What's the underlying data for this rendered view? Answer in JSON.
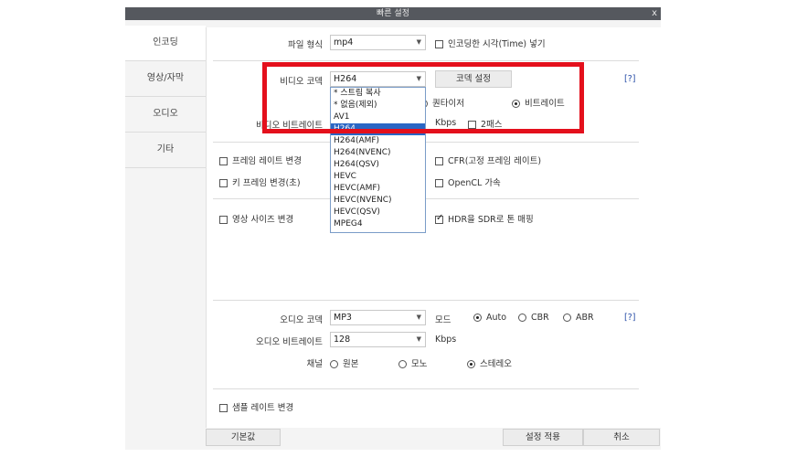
{
  "window": {
    "title": "빠른 설정",
    "close": "x"
  },
  "tabs": [
    {
      "label": "인코딩",
      "active": true
    },
    {
      "label": "영상/자막",
      "active": false
    },
    {
      "label": "오디오",
      "active": false
    },
    {
      "label": "기타",
      "active": false
    }
  ],
  "file_format": {
    "label": "파일 형식",
    "value": "mp4"
  },
  "time_option": {
    "label": "인코딩한 시각(Time) 넣기",
    "checked": false
  },
  "video_codec": {
    "label": "비디오 코덱",
    "value": "H264",
    "settings_button": "코덱 설정",
    "help": "[?]"
  },
  "quality_mode": {
    "options": [
      {
        "label": "퀀타이저",
        "selected": false
      },
      {
        "label": "비트레이트",
        "selected": true
      }
    ]
  },
  "video_bitrate": {
    "label": "비디오 비트레이트",
    "unit": "Kbps",
    "two_pass_label": "2패스",
    "two_pass_checked": false
  },
  "codec_dropdown": {
    "options": [
      "* 스트림 복사",
      "* 없음(제외)",
      "AV1",
      "H264",
      "H264(AMF)",
      "H264(NVENC)",
      "H264(QSV)",
      "HEVC",
      "HEVC(AMF)",
      "HEVC(NVENC)",
      "HEVC(QSV)",
      "MPEG4"
    ],
    "highlighted": "H264"
  },
  "checks": {
    "frame_rate": {
      "label": "프레임 레이트 변경",
      "checked": false
    },
    "cfr": {
      "label": "CFR(고정 프레임 레이트)",
      "checked": false
    },
    "keyframe": {
      "label": "키 프레임 변경(초)",
      "checked": false
    },
    "opencl": {
      "label": "OpenCL 가속",
      "checked": false
    },
    "resize": {
      "label": "영상 사이즈 변경",
      "checked": false
    },
    "hdr": {
      "label": "HDR을 SDR로 톤 매핑",
      "checked": true
    }
  },
  "audio_codec": {
    "label": "오디오 코덱",
    "value": "MP3",
    "mode_label": "모드",
    "help": "[?]",
    "modes": [
      {
        "label": "Auto",
        "selected": true
      },
      {
        "label": "CBR",
        "selected": false
      },
      {
        "label": "ABR",
        "selected": false
      }
    ]
  },
  "audio_bitrate": {
    "label": "오디오 비트레이트",
    "value": "128",
    "unit": "Kbps"
  },
  "channel": {
    "label": "채널",
    "options": [
      {
        "label": "원본",
        "selected": false
      },
      {
        "label": "모노",
        "selected": false
      },
      {
        "label": "스테레오",
        "selected": true
      }
    ]
  },
  "sample_rate": {
    "label": "샘플 레이트 변경",
    "checked": false
  },
  "footer": {
    "default_button": "기본값",
    "apply_button": "설정 적용",
    "cancel_button": "취소"
  },
  "colors": {
    "highlight_box": "#e4101c",
    "titlebar": "#55585e",
    "selection": "#2a66c4"
  }
}
